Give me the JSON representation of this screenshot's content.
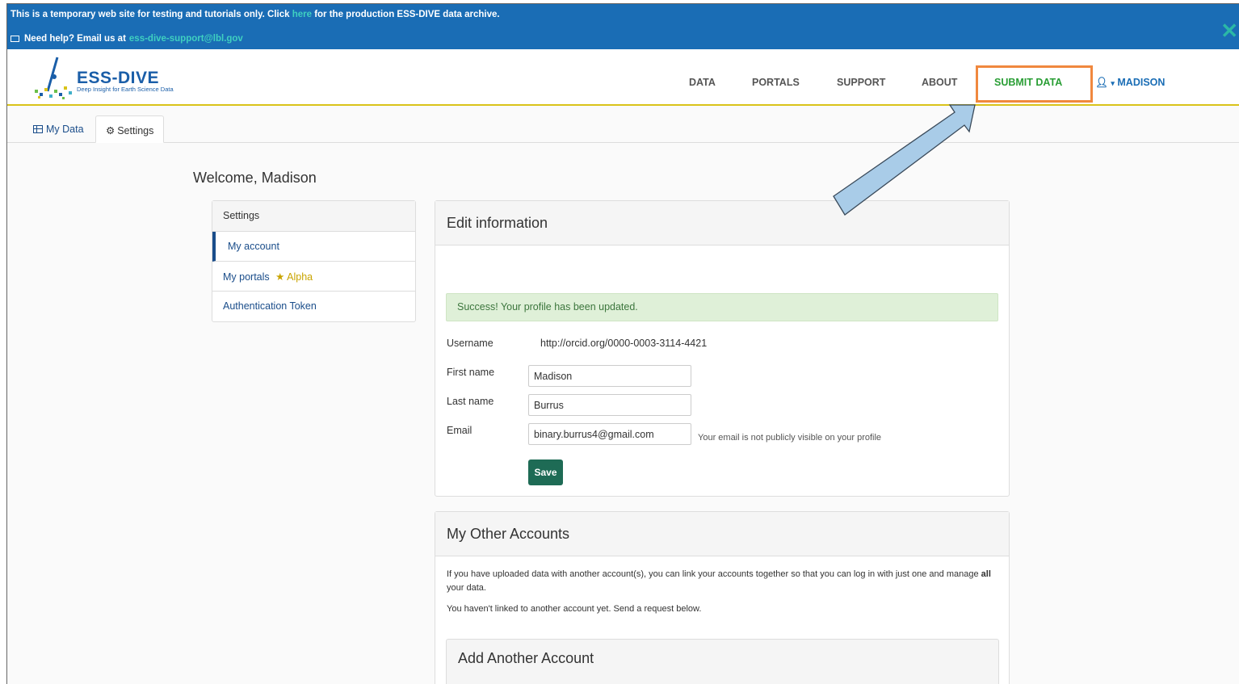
{
  "banner": {
    "line1_pre": "This is a temporary web site for testing and tutorials only. Click",
    "line1_link": "here",
    "line1_post": "for the production ESS-DIVE data archive.",
    "line2_pre": "Need help? Email us at",
    "line2_email": "ess-dive-support@lbl.gov"
  },
  "logo": {
    "title": "ESS-DIVE",
    "subtitle": "Deep Insight for Earth Science Data"
  },
  "nav": {
    "data": "DATA",
    "portals": "PORTALS",
    "support": "SUPPORT",
    "about": "ABOUT",
    "submit": "SUBMIT DATA",
    "user": "MADISON"
  },
  "tabs": {
    "my_data": "My Data",
    "settings": "Settings"
  },
  "welcome": "Welcome, Madison",
  "sidebar": {
    "heading": "Settings",
    "items": [
      {
        "label": "My account"
      },
      {
        "label": "My portals",
        "badge": "Alpha"
      },
      {
        "label": "Authentication Token"
      }
    ]
  },
  "edit": {
    "title": "Edit information",
    "success": "Success! Your profile has been updated.",
    "username_label": "Username",
    "username_value": "http://orcid.org/0000-0003-3114-4421",
    "first_label": "First name",
    "first_value": "Madison",
    "last_label": "Last name",
    "last_value": "Burrus",
    "email_label": "Email",
    "email_value": "binary.burrus4@gmail.com",
    "email_hint": "Your email is not publicly visible on your profile",
    "save": "Save"
  },
  "other": {
    "title": "My Other Accounts",
    "p1_a": "If you have uploaded data with another account(s), you can link your accounts together so that you can log in with just one and manage",
    "p1_b": "all",
    "p1_c": "your data.",
    "p2": "You haven't linked to another account yet. Send a request below.",
    "add_title": "Add Another Account"
  },
  "colors": {
    "banner": "#1a6db5",
    "submit_highlight": "#f0883e",
    "submit_text": "#2a9e35",
    "success_bg": "#dff0d8",
    "save_button": "#1e6b55",
    "annotation_arrow": "#a9cce8"
  }
}
